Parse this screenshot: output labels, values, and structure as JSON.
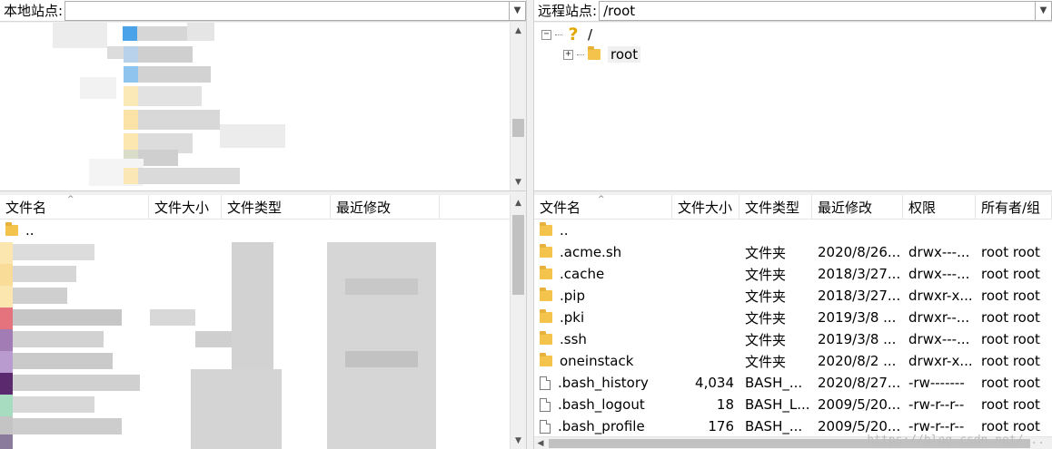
{
  "local": {
    "site_label": "本地站点:",
    "columns": [
      "文件名",
      "文件大小",
      "文件类型",
      "最近修改"
    ],
    "rows": [
      {
        "name": ".."
      }
    ]
  },
  "remote": {
    "site_label": "远程站点:",
    "site_path": "/root",
    "tree": [
      {
        "label": "/"
      },
      {
        "label": "root"
      }
    ],
    "columns": [
      "文件名",
      "文件大小",
      "文件类型",
      "最近修改",
      "权限",
      "所有者/组"
    ],
    "rows": [
      {
        "name": "..",
        "size": "",
        "type": "",
        "modified": "",
        "perms": "",
        "owner": "",
        "icon": "folder"
      },
      {
        "name": ".acme.sh",
        "size": "",
        "type": "文件夹",
        "modified": "2020/8/26...",
        "perms": "drwx---...",
        "owner": "root root",
        "icon": "folder"
      },
      {
        "name": ".cache",
        "size": "",
        "type": "文件夹",
        "modified": "2018/3/27...",
        "perms": "drwx---...",
        "owner": "root root",
        "icon": "folder"
      },
      {
        "name": ".pip",
        "size": "",
        "type": "文件夹",
        "modified": "2018/3/27...",
        "perms": "drwxr-x...",
        "owner": "root root",
        "icon": "folder"
      },
      {
        "name": ".pki",
        "size": "",
        "type": "文件夹",
        "modified": "2019/3/8 ...",
        "perms": "drwxr--...",
        "owner": "root root",
        "icon": "folder"
      },
      {
        "name": ".ssh",
        "size": "",
        "type": "文件夹",
        "modified": "2019/3/8 ...",
        "perms": "drwx---...",
        "owner": "root root",
        "icon": "folder"
      },
      {
        "name": "oneinstack",
        "size": "",
        "type": "文件夹",
        "modified": "2020/8/2 ...",
        "perms": "drwxr-x...",
        "owner": "root root",
        "icon": "folder"
      },
      {
        "name": ".bash_history",
        "size": "4,034",
        "type": "BASH_...",
        "modified": "2020/8/27...",
        "perms": "-rw-------",
        "owner": "root root",
        "icon": "file"
      },
      {
        "name": ".bash_logout",
        "size": "18",
        "type": "BASH_L...",
        "modified": "2009/5/20...",
        "perms": "-rw-r--r--",
        "owner": "root root",
        "icon": "file"
      },
      {
        "name": ".bash_profile",
        "size": "176",
        "type": "BASH_...",
        "modified": "2009/5/20...",
        "perms": "-rw-r--r--",
        "owner": "root root",
        "icon": "file"
      }
    ]
  },
  "colors": {
    "folder": "#f4c34c",
    "scroll_thumb": "#c1c1c1",
    "pane_bg": "#ffffff",
    "frame_bg": "#f0f0f0"
  },
  "watermark": "https://blog.csdn.net/..."
}
